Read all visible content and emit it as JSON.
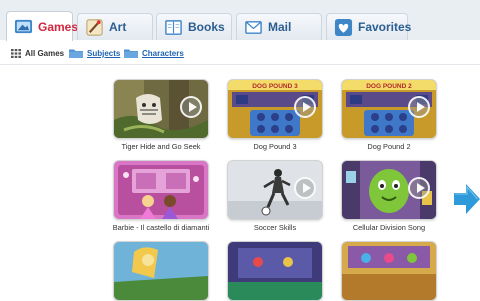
{
  "tabs": [
    {
      "label": "Games",
      "icon": "games-icon",
      "active": true
    },
    {
      "label": "Art",
      "icon": "palette-icon",
      "active": false
    },
    {
      "label": "Books",
      "icon": "book-icon",
      "active": false
    },
    {
      "label": "Mail",
      "icon": "mail-icon",
      "active": false
    },
    {
      "label": "Favorites",
      "icon": "heart-icon",
      "active": false
    }
  ],
  "subnav": {
    "all_games": "All Games",
    "subjects": "Subjects",
    "characters": "Characters"
  },
  "games": [
    {
      "title": "Tiger Hide and Go Seek"
    },
    {
      "title": "Dog Pound 3",
      "banner": "DOG POUND 3"
    },
    {
      "title": "Dog Pound 2",
      "banner": "DOG POUND 2"
    },
    {
      "title": "Barbie - Il castello di diamanti"
    },
    {
      "title": "Soccer Skills"
    },
    {
      "title": "Cellular Division Song"
    }
  ],
  "colors": {
    "tab_active_text": "#d2263e",
    "tab_text": "#2b5f91",
    "link": "#1e63b4",
    "next_arrow": "#2f9ad9"
  },
  "navigation": {
    "next_icon": "arrow-right-icon"
  }
}
